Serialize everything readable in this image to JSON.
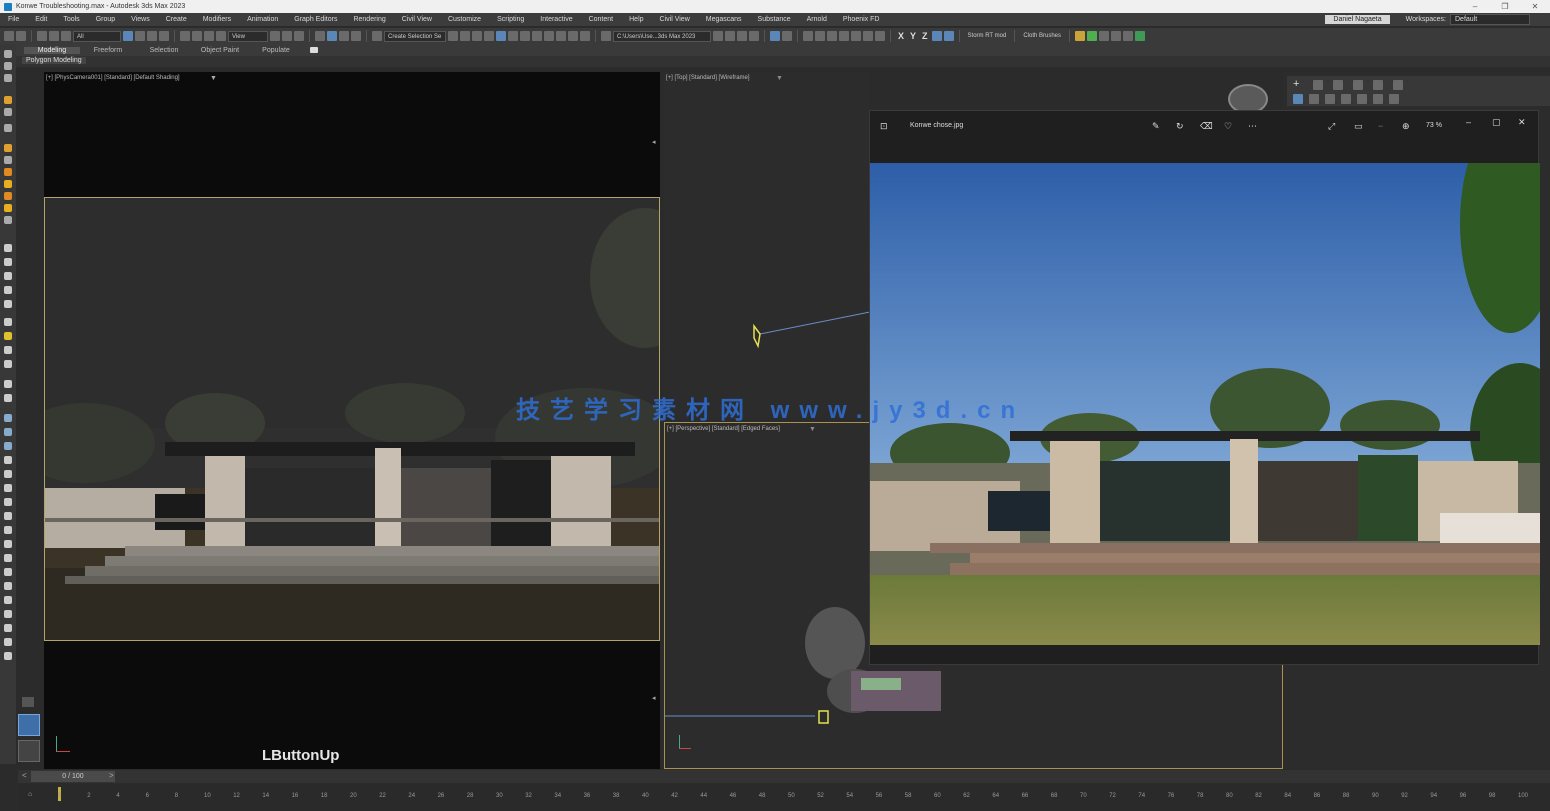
{
  "window": {
    "title": "Konwe Troubleshooting.max - Autodesk 3ds Max 2023",
    "controls": [
      "–",
      "❐",
      "✕"
    ]
  },
  "menu": {
    "items": [
      "File",
      "Edit",
      "Tools",
      "Group",
      "Views",
      "Create",
      "Modifiers",
      "Animation",
      "Graph Editors",
      "Rendering",
      "Civil View",
      "Customize",
      "Scripting",
      "Interactive",
      "Content",
      "Help",
      "Civil View",
      "Megascans",
      "Substance",
      "Arnold",
      "Phoenix FD"
    ],
    "user": "Daniel Nagaeta",
    "workspaces_label": "Workspaces:",
    "workspace_value": "Default"
  },
  "toolbar": {
    "selection_filter": "All",
    "ref_coord": "View",
    "named_selection": "Create Selection Se",
    "project_path": "C:\\Users\\Use...3ds Max 2023",
    "axis_x": "X",
    "axis_y": "Y",
    "axis_z": "Z",
    "storm_rt": "Storm RT mod",
    "cloth_brushes": "Cloth Brushes"
  },
  "ribbon": {
    "tabs": [
      "Modeling",
      "Freeform",
      "Selection",
      "Object Paint",
      "Populate"
    ],
    "active_tab": "Modeling",
    "sub_label": "Polygon Modeling"
  },
  "viewports": {
    "camera_label": "[+] [PhysCamera001] [Standard] [Default Shading]",
    "top_label": "[+] [Top] [Standard] [Wireframe]",
    "persp_label": "[+] [Perspective] [Standard] [Edged Faces]"
  },
  "viewer": {
    "filename": "Konwe chose.jpg",
    "zoom": "73 %"
  },
  "timeline": {
    "frame_display": "0 / 100",
    "ticks": [
      "0",
      "2",
      "4",
      "6",
      "8",
      "10",
      "12",
      "14",
      "16",
      "18",
      "20",
      "22",
      "24",
      "26",
      "28",
      "30",
      "32",
      "34",
      "36",
      "38",
      "40",
      "42",
      "44",
      "46",
      "48",
      "50",
      "52",
      "54",
      "56",
      "58",
      "60",
      "62",
      "64",
      "66",
      "68",
      "70",
      "72",
      "74",
      "76",
      "78",
      "80",
      "82",
      "84",
      "86",
      "88",
      "90",
      "92",
      "94",
      "96",
      "98",
      "100"
    ]
  },
  "status_text": "LButtonUp",
  "watermark": "技艺学习素材网 www.jy3d.cn",
  "colors": {
    "accent": "#5a86b8",
    "safe_frame": "#b5a36a",
    "sky": "#3d6fb8"
  }
}
